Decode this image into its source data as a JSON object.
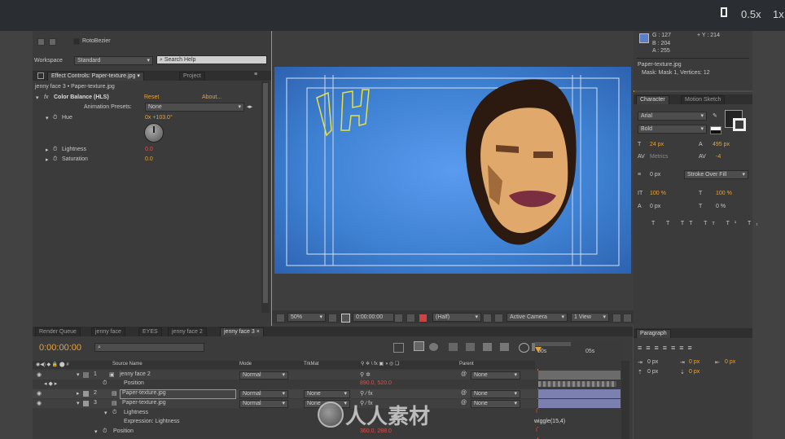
{
  "player": {
    "speed_a": "0.5x",
    "speed_b": "1x"
  },
  "toolbar": {
    "roto_bezier": "RotoBezier",
    "workspace_label": "Workspace",
    "workspace_value": "Standard",
    "search_help": "Search Help"
  },
  "effect_controls": {
    "tab": "Effect Controls: Paper-texture.jpg",
    "tab_project": "Project",
    "layer_path": "jenny face 3 • Paper-texture.jpg",
    "effect_name": "Color Balance (HLS)",
    "reset": "Reset",
    "about": "About...",
    "animation_presets_label": "Animation Presets:",
    "animation_presets_value": "None",
    "hue_label": "Hue",
    "hue_value": "0x +103.0°",
    "lightness_label": "Lightness",
    "lightness_value": "0.0",
    "saturation_label": "Saturation",
    "saturation_value": "0.0"
  },
  "info": {
    "g": "G : 127",
    "b": "B : 204",
    "a": "A : 255",
    "y": "+ Y : 214",
    "file": "Paper-texture.jpg",
    "mask": "Mask: Mask 1, Vertices: 12"
  },
  "character": {
    "tab": "Character",
    "tab2": "Motion Sketch",
    "font": "Arial",
    "style": "Bold",
    "size": "24 px",
    "leading": "495 px",
    "kerning": "Metrics",
    "tracking": "-4",
    "stroke_width": "0 px",
    "stroke_type": "Stroke Over Fill",
    "vscale": "100 %",
    "hscale": "100 %",
    "baseline": "0 px",
    "tsume": "0 %"
  },
  "paragraph": {
    "tab": "Paragraph",
    "indent_values": [
      "0 px",
      "0 px",
      "0 px",
      "0 px",
      "0 px"
    ]
  },
  "viewer": {
    "zoom": "50%",
    "timecode": "0:00:00:00",
    "resolution": "(Half)",
    "camera": "Active Camera",
    "view": "1 View"
  },
  "timeline": {
    "tabs": [
      "Render Queue",
      "jenny face",
      "EYES",
      "jenny face 2",
      "jenny face 3"
    ],
    "timecode": "0:00:00:00",
    "col_source": "Source Name",
    "col_mode": "Mode",
    "col_trkmat": "TrkMat",
    "col_parent": "Parent",
    "ruler_0": "00s",
    "ruler_1": "05s",
    "rows": [
      {
        "num": "1",
        "name": "jenny face 2",
        "mode": "Normal",
        "trkmat": "",
        "parent": "None"
      },
      {
        "num": "2",
        "name": "Paper-texture.jpg",
        "mode": "Normal",
        "trkmat": "None",
        "parent": "None"
      },
      {
        "num": "3",
        "name": "Paper-texture.jpg",
        "mode": "Normal",
        "trkmat": "None",
        "parent": "None"
      }
    ],
    "position_label": "Position",
    "position_value": "890.0, 520.0",
    "lightness_label": "Lightness",
    "expression_label": "Expression: Lightness",
    "expression_value": "wiggle(15,4)",
    "position2_label": "Position",
    "position2_value": "360.0, 288.0"
  },
  "watermark": {
    "text": "人人素材"
  },
  "colors": {
    "accent": "#e8a33a",
    "canvas_blue": "#3d7fd0",
    "panel": "#3b3b3b",
    "timeline_bar": "#7b80b0"
  }
}
